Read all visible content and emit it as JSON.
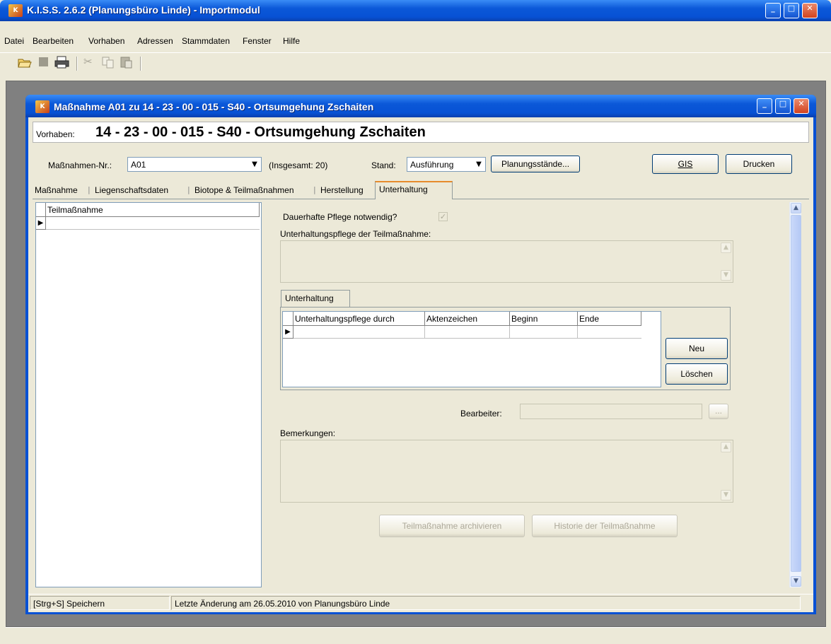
{
  "app": {
    "title": "K.I.S.S. 2.6.2 (Planungsbüro Linde) - Importmodul",
    "icon": "kiss-app-icon"
  },
  "menu": [
    "Datei",
    "Bearbeiten",
    "Vorhaben",
    "Adressen",
    "Stammdaten",
    "Fenster",
    "Hilfe"
  ],
  "toolbar": {
    "icons": [
      "open-folder-icon",
      "stop-icon",
      "print-icon",
      "cut-icon",
      "copy-icon",
      "paste-icon"
    ]
  },
  "child": {
    "title": "Maßnahme A01 zu 14 - 23 - 00 - 015 - S40 - Ortsumgehung Zschaiten",
    "vorhaben_label": "Vorhaben:",
    "vorhaben_value": "14 - 23 - 00 - 015 - S40 - Ortsumgehung Zschaiten",
    "massnahmen_label": "Maßnahmen-Nr.:",
    "massnahmen_value": "A01",
    "insgesamt": "(Insgesamt: 20)",
    "stand_label": "Stand:",
    "stand_value": "Ausführung",
    "planungsstaende": "Planungsstände...",
    "gis": "GIS",
    "drucken": "Drucken",
    "tabs": [
      "Maßnahme",
      "Liegenschaftsdaten",
      "Biotope & Teilmaßnahmen",
      "Herstellung",
      "Unterhaltung"
    ],
    "active_tab": "Unterhaltung",
    "left_grid_header": "Teilmaßnahme",
    "dauerhafte_label": "Dauerhafte Pflege notwendig?",
    "pflege_label": "Unterhaltungspflege der Teilmaßnahme:",
    "inner_tab": "Unterhaltung",
    "inner_grid_headers": [
      "Unterhaltungspflege durch",
      "Aktenzeichen",
      "Beginn",
      "Ende"
    ],
    "neu": "Neu",
    "loeschen": "Löschen",
    "bearbeiter_label": "Bearbeiter:",
    "ellipsis": "...",
    "bemerkungen_label": "Bemerkungen:",
    "archivieren": "Teilmaßnahme archivieren",
    "historie": "Historie der Teilmaßnahme",
    "status_left": "[Strg+S] Speichern",
    "status_right": "Letzte Änderung am 26.05.2010 von Planungsbüro Linde"
  },
  "colors": {
    "xp_blue": "#0751d4",
    "xp_face": "#ece9d8",
    "close_red": "#d3431f"
  }
}
